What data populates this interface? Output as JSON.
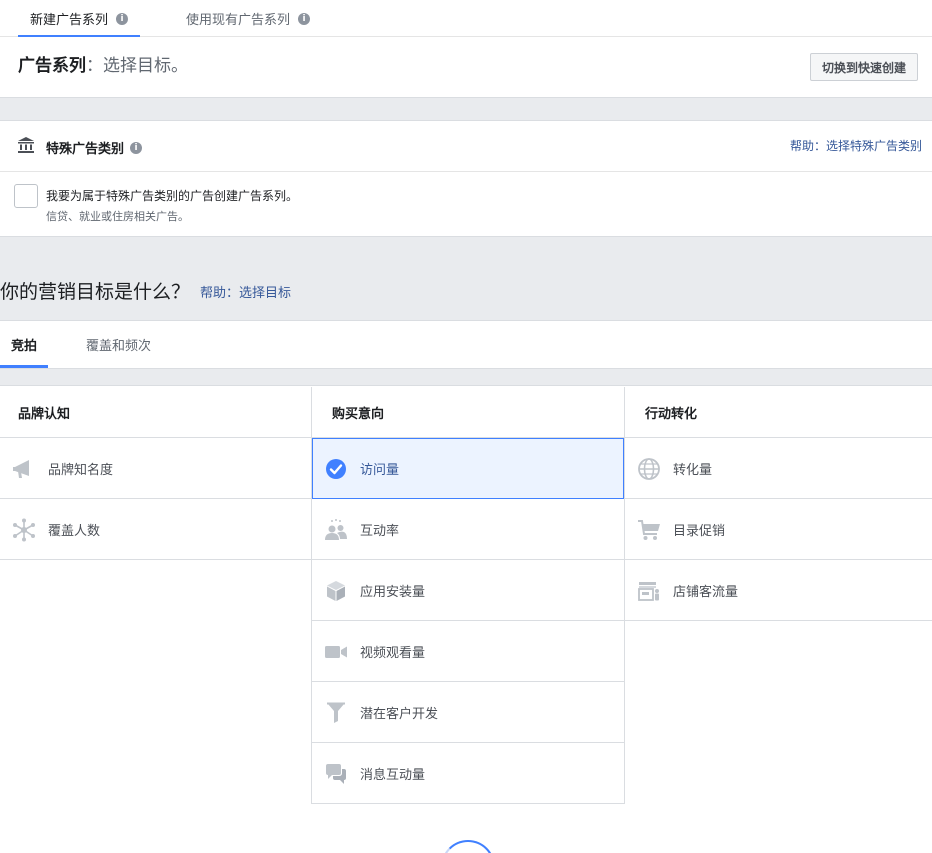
{
  "top_tabs": {
    "new_campaign": "新建广告系列",
    "existing_campaign": "使用现有广告系列"
  },
  "header": {
    "title_strong": "广告系列",
    "title_rest": "：选择目标。",
    "quick_create_button": "切换到快速创建"
  },
  "special": {
    "title": "特殊广告类别",
    "help_link": "帮助：选择特殊广告类别",
    "checkbox_label": "我要为属于特殊广告类别的广告创建广告系列。",
    "checkbox_sub": "信贷、就业或住房相关广告。"
  },
  "objective": {
    "question": "你的营销目标是什么？",
    "help_link": "帮助：选择目标"
  },
  "buying_tabs": {
    "auction": "竞拍",
    "reach_frequency": "覆盖和频次"
  },
  "columns": {
    "awareness": {
      "header": "品牌认知",
      "items": [
        {
          "label": "品牌知名度",
          "icon": "megaphone-icon"
        },
        {
          "label": "覆盖人数",
          "icon": "reach-icon"
        }
      ]
    },
    "consideration": {
      "header": "购买意向",
      "items": [
        {
          "label": "访问量",
          "icon": "checkmark-icon",
          "selected": true
        },
        {
          "label": "互动率",
          "icon": "people-icon"
        },
        {
          "label": "应用安装量",
          "icon": "box-icon"
        },
        {
          "label": "视频观看量",
          "icon": "video-camera-icon"
        },
        {
          "label": "潜在客户开发",
          "icon": "funnel-icon"
        },
        {
          "label": "消息互动量",
          "icon": "chat-bubbles-icon"
        }
      ]
    },
    "conversion": {
      "header": "行动转化",
      "items": [
        {
          "label": "转化量",
          "icon": "globe-icon"
        },
        {
          "label": "目录促销",
          "icon": "cart-icon"
        },
        {
          "label": "店铺客流量",
          "icon": "store-icon"
        }
      ]
    }
  },
  "colors": {
    "accent": "#4080ff",
    "link": "#365899",
    "icon": "#bec3c9",
    "band": "#e9ebee"
  }
}
